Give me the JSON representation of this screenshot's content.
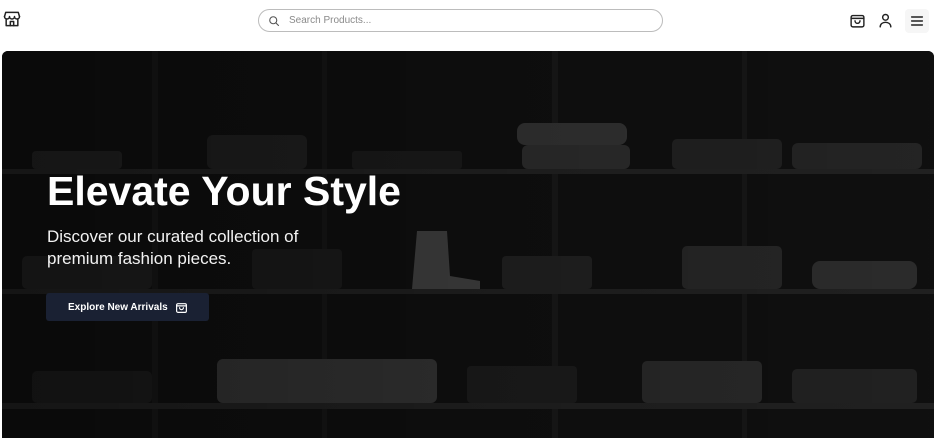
{
  "header": {
    "logo_icon": "store-icon",
    "search": {
      "placeholder": "Search Products...",
      "value": "",
      "icon": "search-icon"
    },
    "actions": [
      {
        "name": "cart",
        "icon": "shopping-bag-icon"
      },
      {
        "name": "account",
        "icon": "user-icon"
      },
      {
        "name": "menu",
        "icon": "hamburger-menu-icon"
      }
    ]
  },
  "hero": {
    "title": "Elevate Your Style",
    "subtitle": "Discover our curated collection of premium fashion pieces.",
    "cta": {
      "label": "Explore New Arrivals",
      "icon": "shopping-bag-icon"
    }
  },
  "colors": {
    "hero_overlay": "#141414",
    "cta_background": "#1a2133",
    "text_light": "#ffffff",
    "search_border": "#bcbcbc"
  }
}
